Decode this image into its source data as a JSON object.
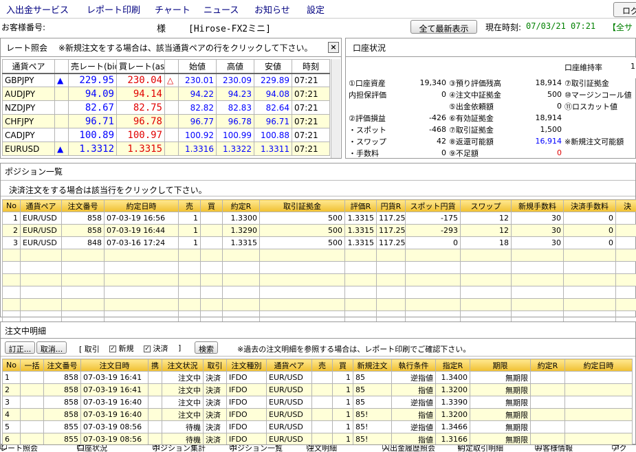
{
  "menu": [
    "入出金サービス",
    "レポート印刷",
    "チャート",
    "ニュース",
    "お知らせ",
    "設定"
  ],
  "logout": "ログ",
  "customer": {
    "label": "お客様番号:",
    "sama": "様",
    "product": "[Hirose-FX2ミニ]",
    "refresh": "全て最新表示",
    "time_label": "現在時刻:",
    "time": "07/03/21 07:21",
    "status": "【全サ"
  },
  "rate": {
    "title": "レート照会",
    "note": "※新規注文をする場合は、該当通貨ペアの行をクリックして下さい。",
    "close": "×",
    "headers": [
      "通貨ペア",
      "",
      "売レート(bid)",
      "買レート(ask)",
      "",
      "始値",
      "高値",
      "安値",
      "時刻"
    ],
    "rows": [
      {
        "pair": "GBPJPY",
        "up1": "▲",
        "bid": "229.95",
        "ask": "230.04",
        "up2": "△",
        "open": "230.01",
        "high": "230.09",
        "low": "229.89",
        "time": "07:21"
      },
      {
        "pair": "AUDJPY",
        "up1": "",
        "bid": "94.09",
        "ask": "94.14",
        "up2": "",
        "open": "94.22",
        "high": "94.23",
        "low": "94.08",
        "time": "07:21"
      },
      {
        "pair": "NZDJPY",
        "up1": "",
        "bid": "82.67",
        "ask": "82.75",
        "up2": "",
        "open": "82.82",
        "high": "82.83",
        "low": "82.64",
        "time": "07:21"
      },
      {
        "pair": "CHFJPY",
        "up1": "",
        "bid": "96.71",
        "ask": "96.78",
        "up2": "",
        "open": "96.77",
        "high": "96.78",
        "low": "96.71",
        "time": "07:21"
      },
      {
        "pair": "CADJPY",
        "up1": "",
        "bid": "100.89",
        "ask": "100.97",
        "up2": "",
        "open": "100.92",
        "high": "100.99",
        "low": "100.88",
        "time": "07:21"
      },
      {
        "pair": "EURUSD",
        "up1": "▲",
        "bid": "1.3312",
        "ask": "1.3315",
        "up2": "",
        "open": "1.3316",
        "high": "1.3322",
        "low": "1.3311",
        "time": "07:21"
      }
    ]
  },
  "account": {
    "title": "口座状況",
    "maint": "口座維持率",
    "maint_val": "1",
    "rows": [
      [
        "①口座資産",
        "19,340",
        "③預り評価残高",
        "18,914",
        "⑦取引証拠金"
      ],
      [
        "内担保評価",
        "0",
        "④注文中証拠金",
        "500",
        "⑩マージンコール値"
      ],
      [
        "",
        "",
        "⑤出金依頼額",
        "0",
        "⑪ロスカット値"
      ],
      [
        "②評価損益",
        "-426",
        "⑥有効証拠金",
        "18,914",
        ""
      ],
      [
        "・スポット",
        "-468",
        "⑦取引証拠金",
        "1,500",
        ""
      ],
      [
        "・スワップ",
        "42",
        "⑧返還可能額",
        "16,914",
        "※新規注文可能額"
      ],
      [
        "・手数料",
        "0",
        "⑨不足額",
        "0",
        ""
      ]
    ]
  },
  "positions": {
    "title": "ポジション一覧",
    "note": "決済注文をする場合は該当行をクリックして下さい。",
    "headers": [
      "No",
      "通貨ペア",
      "注文番号",
      "約定日時",
      "売",
      "買",
      "約定R",
      "取引証拠金",
      "評価R",
      "円貨R",
      "スポット円貨",
      "スワップ",
      "新規手数料",
      "決済手数料",
      "決"
    ],
    "rows": [
      [
        "1",
        "EUR/USD",
        "858",
        "07-03-19 16:56",
        "1",
        "",
        "1.3300",
        "500",
        "1.3315",
        "117.25",
        "-175",
        "12",
        "30",
        "0",
        ""
      ],
      [
        "2",
        "EUR/USD",
        "858",
        "07-03-19 16:44",
        "1",
        "",
        "1.3290",
        "500",
        "1.3315",
        "117.25",
        "-293",
        "12",
        "30",
        "0",
        ""
      ],
      [
        "3",
        "EUR/USD",
        "848",
        "07-03-16 17:24",
        "1",
        "",
        "1.3315",
        "500",
        "1.3315",
        "117.25",
        "0",
        "18",
        "30",
        "0",
        ""
      ]
    ]
  },
  "orders": {
    "title": "注文中明細",
    "btn_modify": "訂正...",
    "btn_cancel": "取消...",
    "filter_label": "[ 取引",
    "filter_new": "新規",
    "filter_settle": "決済",
    "filter_end": "]",
    "search": "検索",
    "note": "※過去の注文明細を参照する場合は、レポート印刷でご確認下さい。",
    "headers": [
      "No",
      "一括",
      "注文番号",
      "注文日時",
      "携",
      "注文状況",
      "取引",
      "注文種別",
      "通貨ペア",
      "売",
      "買",
      "新規注文",
      "執行条件",
      "指定R",
      "期限",
      "約定R",
      "約定日時"
    ],
    "rows": [
      [
        "1",
        "",
        "858",
        "07-03-19 16:41",
        "",
        "注文中",
        "決済",
        "IFDO",
        "EUR/USD",
        "",
        "1",
        "85",
        "逆指値",
        "1.3400",
        "無期限",
        "",
        ""
      ],
      [
        "2",
        "",
        "858",
        "07-03-19 16:41",
        "",
        "注文中",
        "決済",
        "IFDO",
        "EUR/USD",
        "",
        "1",
        "85",
        "指値",
        "1.3200",
        "無期限",
        "",
        ""
      ],
      [
        "3",
        "",
        "858",
        "07-03-19 16:40",
        "",
        "注文中",
        "決済",
        "IFDO",
        "EUR/USD",
        "",
        "1",
        "85",
        "逆指値",
        "1.3390",
        "無期限",
        "",
        ""
      ],
      [
        "4",
        "",
        "858",
        "07-03-19 16:40",
        "",
        "注文中",
        "決済",
        "IFDO",
        "EUR/USD",
        "",
        "1",
        "85!",
        "指値",
        "1.3200",
        "無期限",
        "",
        ""
      ],
      [
        "5",
        "",
        "855",
        "07-03-19 08:56",
        "",
        "待機",
        "決済",
        "IFDO",
        "EUR/USD",
        "",
        "1",
        "85!",
        "逆指値",
        "1.3466",
        "無期限",
        "",
        ""
      ],
      [
        "6",
        "",
        "855",
        "07-03-19 08:56",
        "",
        "待機",
        "決済",
        "IFDO",
        "EUR/USD",
        "",
        "1",
        "85!",
        "指値",
        "1.3166",
        "無期限",
        "",
        ""
      ]
    ]
  },
  "bottom": [
    "レート照会",
    "口座状況",
    "ポジション集計",
    "ポジション一覧",
    "注文明細",
    "入出金履歴照会",
    "約定取引明細",
    "お客様情報",
    "アク"
  ]
}
